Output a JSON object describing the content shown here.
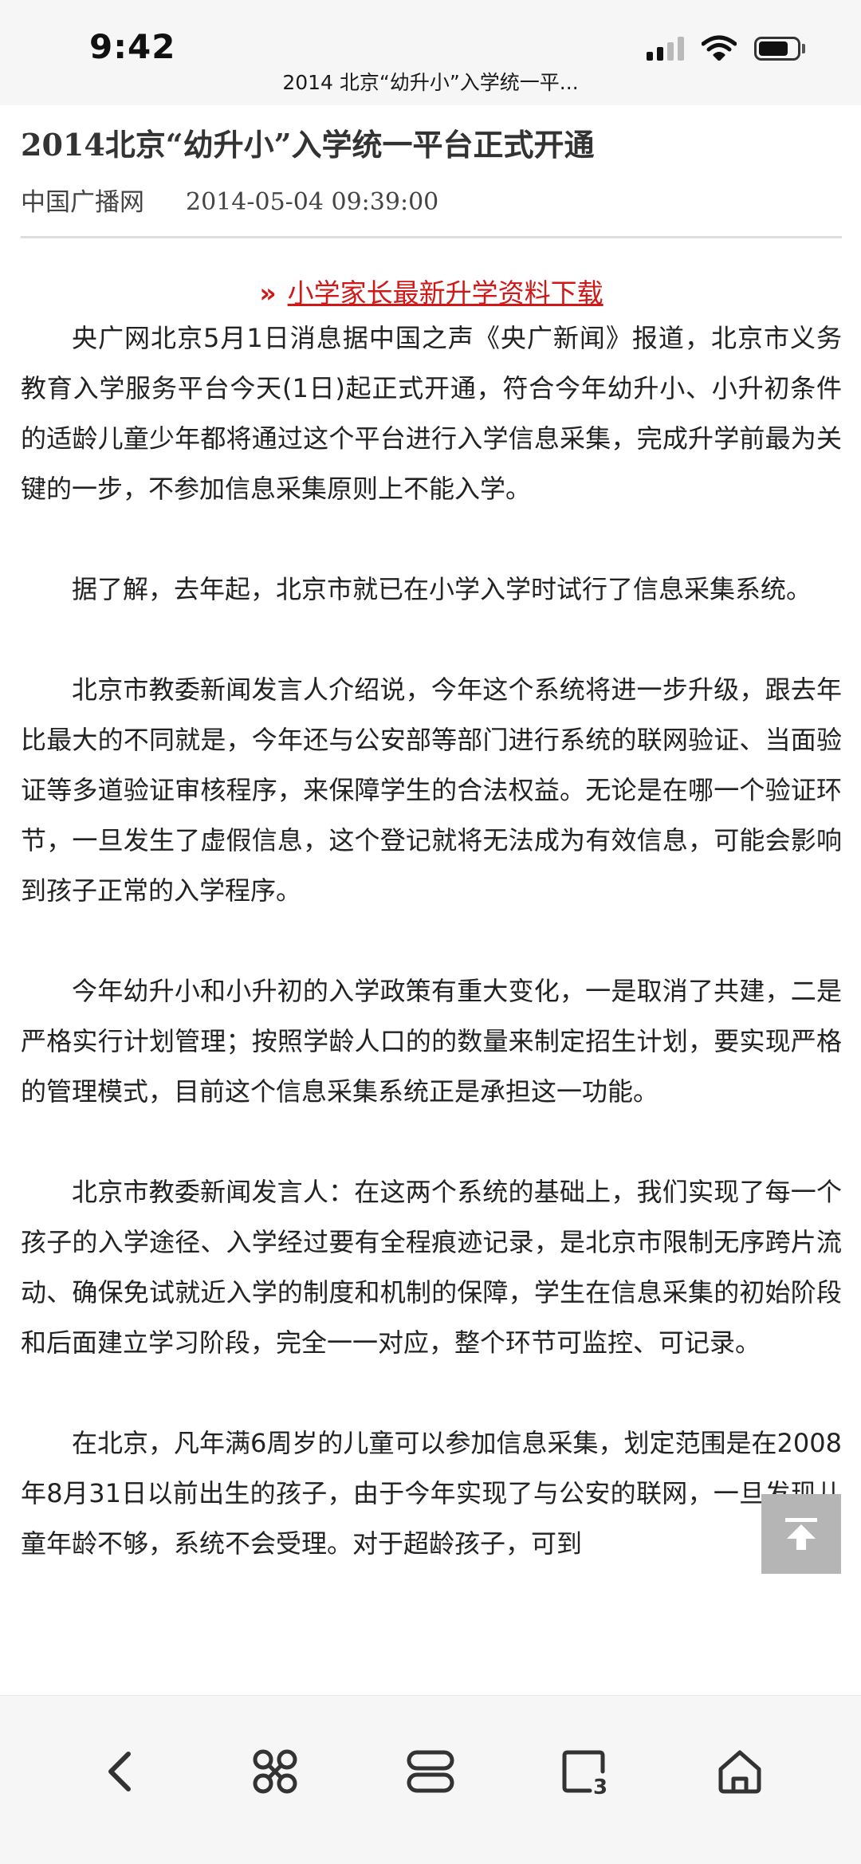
{
  "status_bar": {
    "time": "9:42",
    "page_url": "2014 北京“幼升小”入学统一平...",
    "icons": [
      "signal-icon",
      "wifi-icon",
      "battery-icon"
    ]
  },
  "article": {
    "title": "2014北京“幼升小”入学统一平台正式开通",
    "source": "中国广播网",
    "date": "2014-05-04 09:39:00",
    "promo_arrow": "»",
    "promo_link": "小学家长最新升学资料下载",
    "paragraphs": [
      "央广网北京5月1日消息据中国之声《央广新闻》报道，北京市义务教育入学服务平台今天(1日)起正式开通，符合今年幼升小、小升初条件的适龄儿童少年都将通过这个平台进行入学信息采集，完成升学前最为关键的一步，不参加信息采集原则上不能入学。",
      "据了解，去年起，北京市就已在小学入学时试行了信息采集系统。",
      "北京市教委新闻发言人介绍说，今年这个系统将进一步升级，跟去年比最大的不同就是，今年还与公安部等部门进行系统的联网验证、当面验证等多道验证审核程序，来保障学生的合法权益。无论是在哪一个验证环节，一旦发生了虚假信息，这个登记就将无法成为有效信息，可能会影响到孩子正常的入学程序。",
      "今年幼升小和小升初的入学政策有重大变化，一是取消了共建，二是严格实行计划管理；按照学龄人口的的数量来制定招生计划，要实现严格的管理模式，目前这个信息采集系统正是承担这一功能。",
      "北京市教委新闻发言人：在这两个系统的基础上，我们实现了每一个孩子的入学途径、入学经过要有全程痕迹记录，是北京市限制无序跨片流动、确保免试就近入学的制度和机制的保障，学生在信息采集的初始阶段和后面建立学习阶段，完全一一对应，整个环节可监控、可记录。",
      "在北京，凡年满6周岁的儿童可以参加信息采集，划定范围是在2008年8月31日以前出生的孩子，由于今年实现了与公安的联网，一旦发现儿童年龄不够，系统不会受理。对于超龄孩子，可到"
    ]
  },
  "back_to_top": {
    "icon": "back-to-top-icon"
  },
  "bottom_nav": {
    "items": [
      {
        "name": "back-button",
        "icon": "chevron-left-icon"
      },
      {
        "name": "menu-button",
        "icon": "command-icon"
      },
      {
        "name": "tabs-button",
        "icon": "tabs-icon"
      },
      {
        "name": "tab-count-button",
        "icon": "tab-count-icon",
        "count": "3"
      },
      {
        "name": "home-button",
        "icon": "home-icon"
      }
    ]
  }
}
